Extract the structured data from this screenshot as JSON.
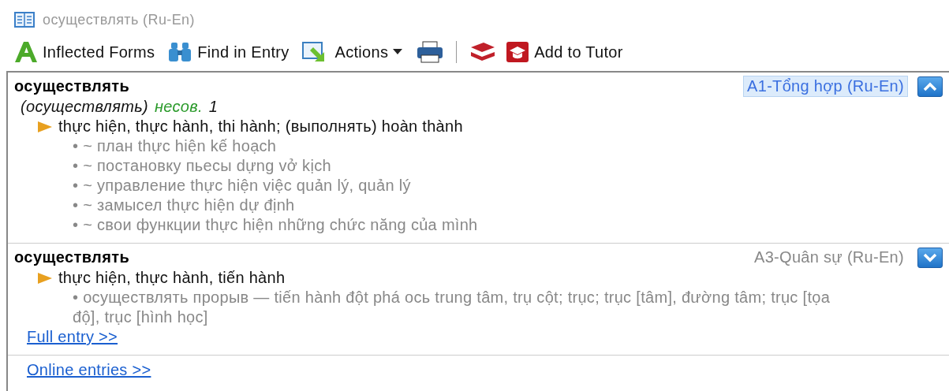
{
  "window": {
    "title": "осуществлять (Ru-En)"
  },
  "toolbar": [
    {
      "kind": "button",
      "label": "Inflected Forms"
    },
    {
      "kind": "button",
      "label": "Find in Entry"
    },
    {
      "kind": "menu",
      "label": "Actions"
    },
    {
      "kind": "icon"
    },
    {
      "kind": "separator"
    },
    {
      "kind": "icon"
    },
    {
      "kind": "button",
      "label": "Add to Tutor"
    }
  ],
  "entries": [
    {
      "headword": "осуществлять",
      "dictionary": "A1-Tổng hợp (Ru-En)",
      "selected": true,
      "expanded": true,
      "grammar": {
        "form": "(осуществлять)",
        "aspect": "несов.",
        "number": "1"
      },
      "sense": "thực hiện, thực hành, thi hành; (выполнять) hoàn thành",
      "examples": [
        "• ~ план thực hiện kế hoạch",
        "• ~ постановку пьесы dựng vở kịch",
        "• ~ управление thực hiện việc quản lý, quản lý",
        "• ~ замысел thực hiện dự định",
        "• ~ свои функции thực hiện những chức năng của mình"
      ]
    },
    {
      "headword": "осуществлять",
      "dictionary": "A3-Quân sự (Ru-En)",
      "selected": false,
      "expanded": false,
      "sense": "thực hiện, thực hành, tiến hành",
      "examples": [
        "• осуществлять прорыв — tiến hành đột phá ось trung tâm, trụ cột; trục; trục [tâm], đường tâm; trục [tọa độ], trục [hình học]"
      ],
      "link": "Full entry >>"
    }
  ],
  "footer_link": "Online entries >>"
}
